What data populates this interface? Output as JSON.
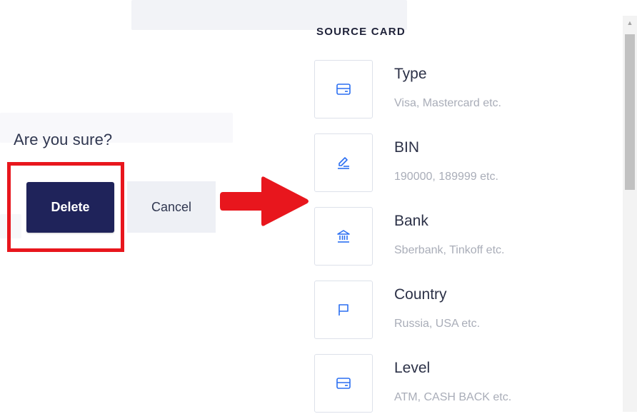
{
  "confirm": {
    "question": "Are you sure?",
    "delete_label": "Delete",
    "cancel_label": "Cancel"
  },
  "annotation": {
    "highlight_color": "#e8161d",
    "arrow_color": "#e8161d"
  },
  "source_card": {
    "heading": "SOURCE CARD",
    "items": [
      {
        "icon": "credit-card-icon",
        "label": "Type",
        "hint": "Visa, Mastercard etc."
      },
      {
        "icon": "edit-pen-icon",
        "label": "BIN",
        "hint": "190000, 189999 etc."
      },
      {
        "icon": "bank-icon",
        "label": "Bank",
        "hint": "Sberbank, Tinkoff etc."
      },
      {
        "icon": "flag-icon",
        "label": "Country",
        "hint": "Russia, USA etc."
      },
      {
        "icon": "credit-card-icon",
        "label": "Level",
        "hint": "ATM, CASH BACK etc."
      }
    ]
  },
  "colors": {
    "primary": "#1f235a",
    "icon_blue": "#2b6ff2",
    "hint_gray": "#a9adb8"
  }
}
